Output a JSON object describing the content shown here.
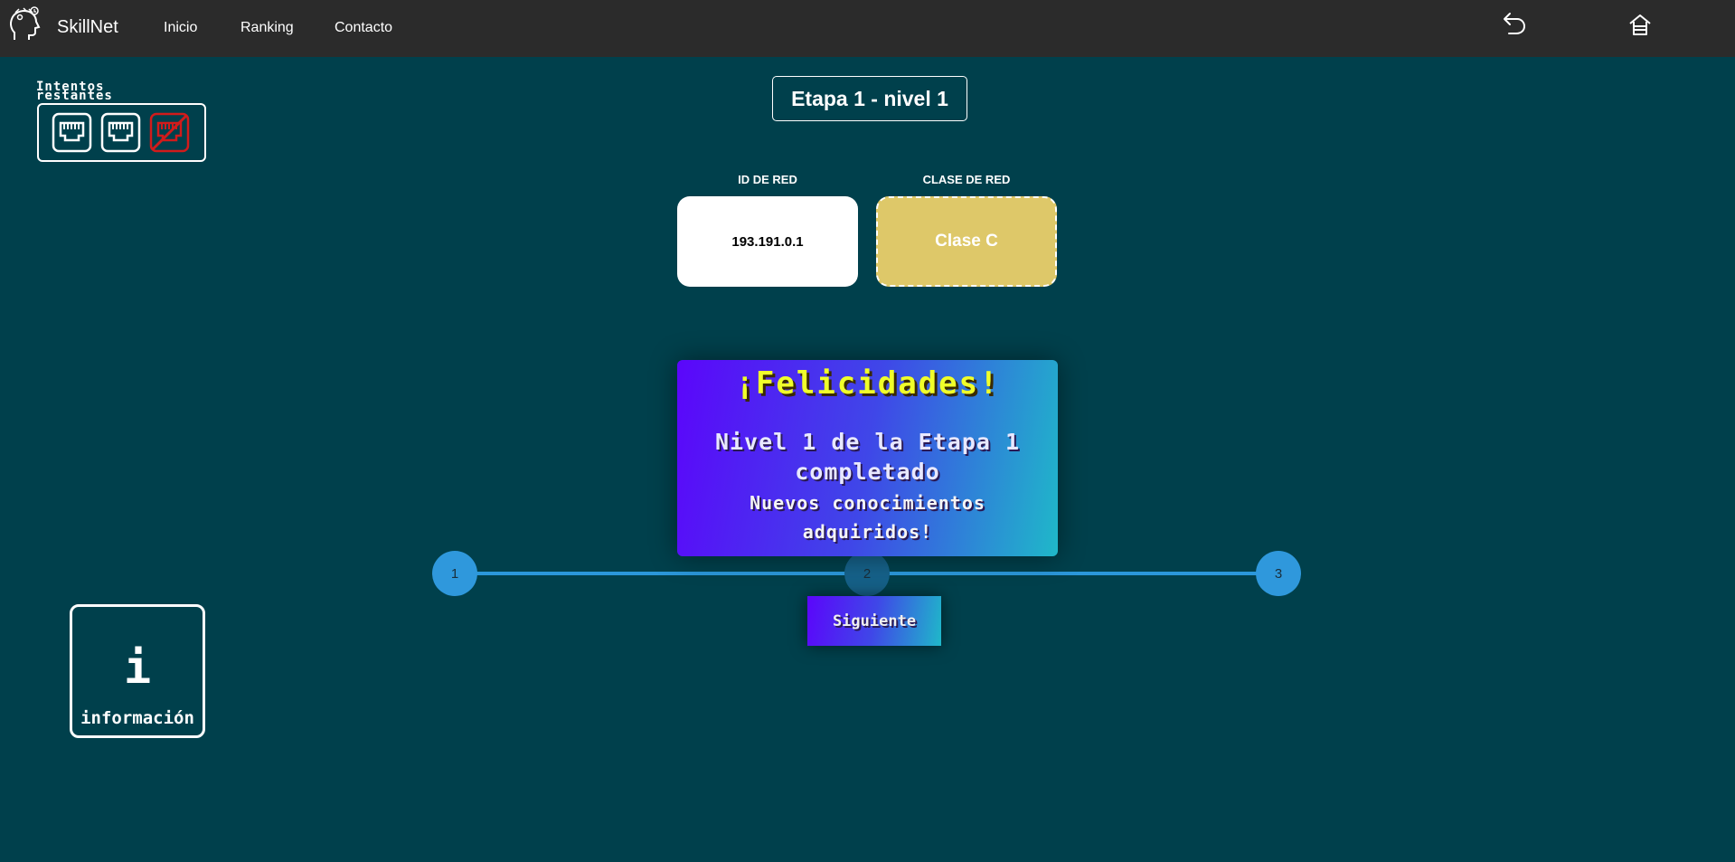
{
  "navbar": {
    "brand": "SkillNet",
    "links": [
      "Inicio",
      "Ranking",
      "Contacto"
    ],
    "logo_icon": "brain-head-icon",
    "back_icon": "back-arrow-icon",
    "home_icon": "home-icon"
  },
  "attempts": {
    "label": "Intentos restantes",
    "total": 3,
    "remaining": 2,
    "icons": [
      "ethernet-port-icon",
      "ethernet-port-icon",
      "ethernet-port-crossed-icon"
    ],
    "lost_color": "#d11b1b"
  },
  "stage": {
    "title": "Etapa 1 - nivel 1"
  },
  "cards": {
    "network_id_label": "ID DE RED",
    "network_id_value": "193.191.0.1",
    "network_class_label": "CLASE DE RED",
    "network_class_value": "Clase C"
  },
  "congrats": {
    "title": "¡Felicidades!",
    "level_line1": "Nivel 1 de la Etapa 1",
    "level_line2": "completado",
    "sub_line1": "Nuevos conocimientos",
    "sub_line2": "adquiridos!",
    "next_button": "Siguiente"
  },
  "progress": {
    "steps": [
      "1",
      "2",
      "3"
    ],
    "current": 2
  },
  "info": {
    "glyph": "i",
    "label": "información"
  },
  "colors": {
    "background": "#00404c",
    "navbar": "#2b2b2b",
    "accent_yellow": "#dec869",
    "progress_blue": "#2b97da"
  }
}
